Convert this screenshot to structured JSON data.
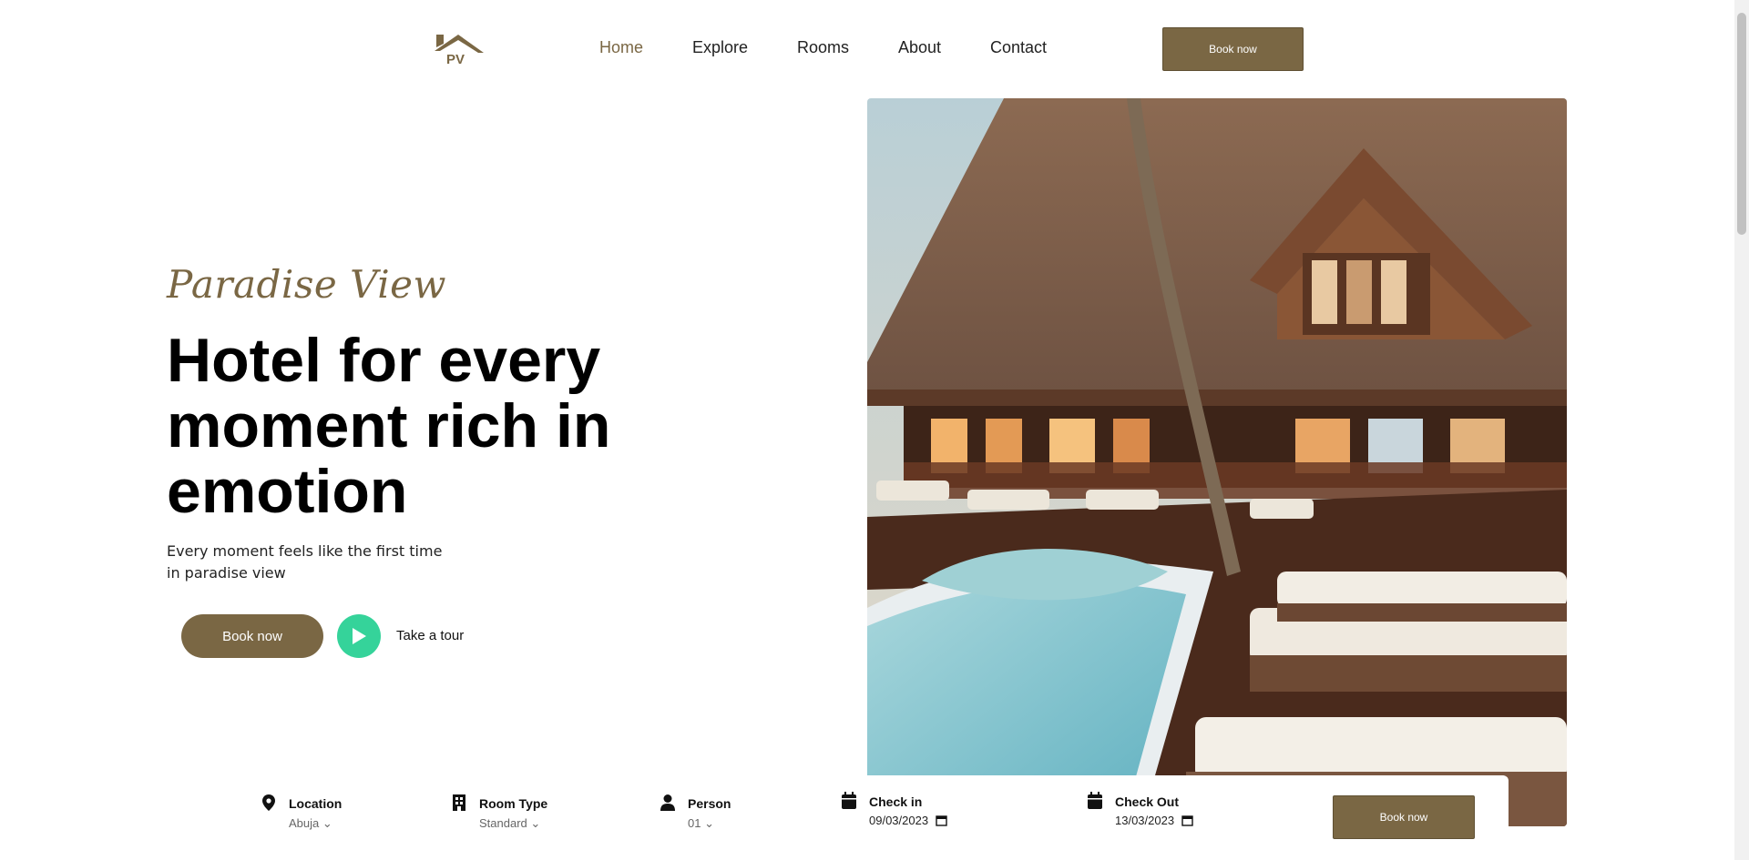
{
  "logo": {
    "text": "PV"
  },
  "nav": {
    "items": [
      {
        "label": "Home",
        "active": true
      },
      {
        "label": "Explore"
      },
      {
        "label": "Rooms"
      },
      {
        "label": "About"
      },
      {
        "label": "Contact"
      }
    ],
    "book_label": "Book now"
  },
  "hero": {
    "brand": "Paradise View",
    "headline": "Hotel for every moment rich in emotion",
    "subtext_line1": "Every moment feels like the first time",
    "subtext_line2": "in paradise view",
    "book_label": "Book now",
    "tour_label": "Take a tour",
    "accent": "#7a6744",
    "play_color": "#35d39a"
  },
  "booking": {
    "location": {
      "label": "Location",
      "value": "Abuja",
      "icon": "location-pin-icon"
    },
    "room_type": {
      "label": "Room Type",
      "value": "Standard",
      "icon": "building-icon"
    },
    "person": {
      "label": "Person",
      "value": "01",
      "icon": "person-icon"
    },
    "check_in": {
      "label": "Check in",
      "value": "09/03/2023",
      "icon": "calendar-icon"
    },
    "check_out": {
      "label": "Check Out",
      "value": "13/03/2023",
      "icon": "calendar-icon"
    },
    "book_label": "Book now"
  }
}
